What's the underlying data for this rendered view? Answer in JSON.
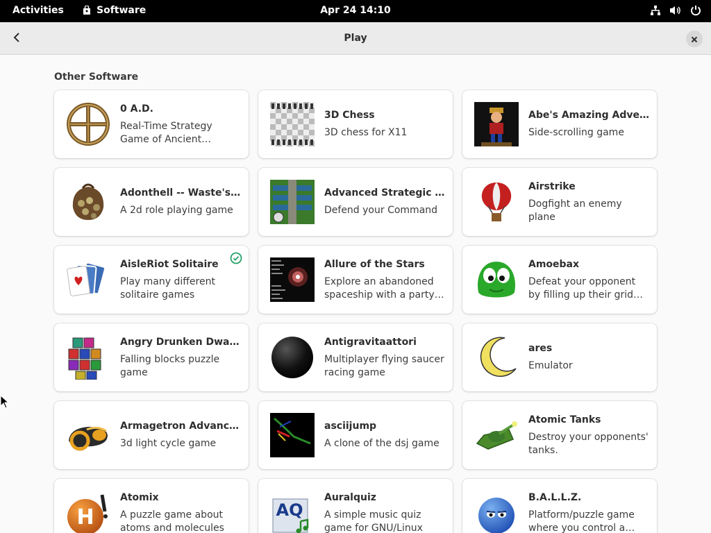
{
  "topbar": {
    "activities": "Activities",
    "app_name": "Software",
    "clock": "Apr 24  14:10"
  },
  "header": {
    "title": "Play"
  },
  "section": {
    "title": "Other Software"
  },
  "apps": [
    {
      "name": "0 A.D.",
      "summary": "Real-Time Strategy Game of Ancient Warfare",
      "icon": "0ad-icon"
    },
    {
      "name": "3D Chess",
      "summary": "3D chess for X11",
      "icon": "3d-chess-icon"
    },
    {
      "name": "Abe's Amazing Adventure",
      "summary": "Side-scrolling game",
      "icon": "abes-adventure-icon"
    },
    {
      "name": "Adonthell -- Waste's Edge",
      "summary": "A 2d role playing game",
      "icon": "adonthell-icon"
    },
    {
      "name": "Advanced Strategic Command",
      "summary": "Defend your Command",
      "icon": "asc-icon"
    },
    {
      "name": "Airstrike",
      "summary": "Dogfight an enemy plane",
      "icon": "airstrike-balloon-icon"
    },
    {
      "name": "AisleRiot Solitaire",
      "summary": "Play many different solitaire games",
      "icon": "aisleriot-cards-icon",
      "installed": true
    },
    {
      "name": "Allure of the Stars",
      "summary": "Explore an abandoned spaceship with a party of heroes",
      "icon": "allure-stars-icon"
    },
    {
      "name": "Amoebax",
      "summary": "Defeat your opponent by filling up their grid with amoebas",
      "icon": "amoebax-icon"
    },
    {
      "name": "Angry Drunken Dwarves",
      "summary": "Falling blocks puzzle game",
      "icon": "angry-dwarves-icon"
    },
    {
      "name": "Antigravitaattori",
      "summary": "Multiplayer flying saucer racing game",
      "icon": "antigravitaattori-icon"
    },
    {
      "name": "ares",
      "summary": "Emulator",
      "icon": "ares-moon-icon"
    },
    {
      "name": "Armagetron Advanced",
      "summary": "3d light cycle game",
      "icon": "armagetron-icon"
    },
    {
      "name": "asciijump",
      "summary": "A clone of the dsj game",
      "icon": "asciijump-icon"
    },
    {
      "name": "Atomic Tanks",
      "summary": "Destroy your opponents' tanks.",
      "icon": "atomic-tanks-icon"
    },
    {
      "name": "Atomix",
      "summary": "A puzzle game about atoms and molecules",
      "icon": "atomix-icon"
    },
    {
      "name": "Auralquiz",
      "summary": "A simple music quiz game for GNU/Linux",
      "icon": "auralquiz-icon"
    },
    {
      "name": "B.A.L.L.Z.",
      "summary": "Platform/puzzle game where you control a rolling ball",
      "icon": "ballz-icon"
    }
  ],
  "icon_texts": {
    "auralquiz": "AQ",
    "atomix": "H"
  },
  "colors": {
    "topbar": "#000000",
    "headerbar": "#ebebeb",
    "background": "#fafafa",
    "installed_check": "#26a269"
  }
}
